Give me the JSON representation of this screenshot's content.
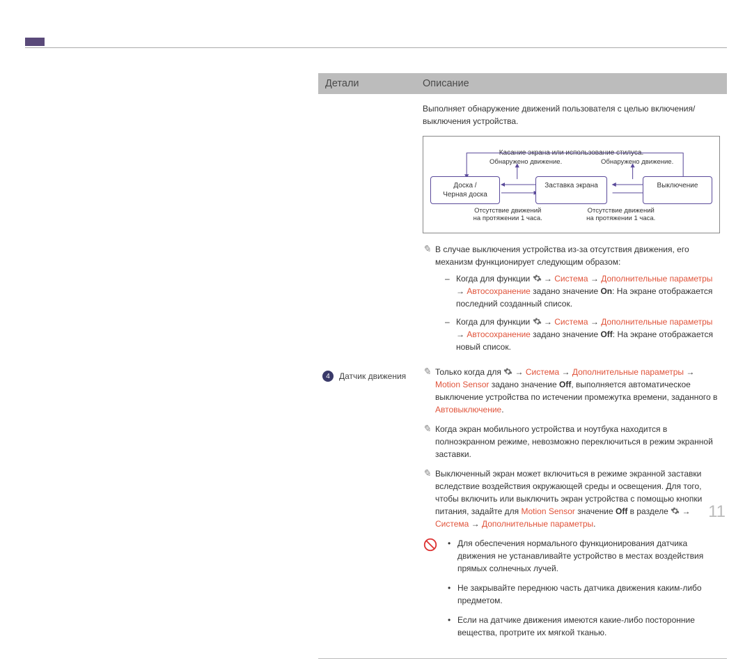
{
  "page_number": "11",
  "header": {
    "col1": "Детали",
    "col2": "Описание"
  },
  "row_label": {
    "num": "4",
    "text": "Датчик движения"
  },
  "intro": "Выполняет обнаружение движений пользователя с целью включения/выключения устройства.",
  "diagram": {
    "top_label": "Касание экрана или использование стилуса.",
    "detected1": "Обнаружено движение.",
    "detected2": "Обнаружено движение.",
    "box1_l1": "Доска /",
    "box1_l2": "Черная доска",
    "box2": "Заставка экрана",
    "box3": "Выключение",
    "no_motion1_l1": "Отсутствие движений",
    "no_motion1_l2": "на протяжении 1 часа.",
    "no_motion2_l1": "Отсутствие движений",
    "no_motion2_l2": "на протяжении 1 часа."
  },
  "notes": {
    "n1_intro": "В случае выключения устройства из-за отсутствия движения, его механизм функционирует следующим образом:",
    "n1_i1_a": "Когда для функции ",
    "n1_i1_b": " → ",
    "n1_i1_sys": "Система",
    "n1_i1_arr": " → ",
    "n1_i1_adv": "Дополнительные параметры",
    "n1_i1_arr2": " → ",
    "n1_i1_auto": "Автосохранение",
    "n1_i1_rest": " задано значение ",
    "n1_i1_on": "On",
    "n1_i1_tail": ": На экране отображается последний созданный список.",
    "n1_i2_a": "Когда для функции ",
    "n1_i2_rest": " задано значение ",
    "n1_i2_off": "Off",
    "n1_i2_tail": ": На экране отображается новый список.",
    "n2_a": "Только когда для ",
    "n2_ms": "Motion Sensor",
    "n2_mid": " задано значение ",
    "n2_off": "Off",
    "n2_mid2": ", выполняется автоматическое выключение устройства по истечении промежутка времени, заданного в ",
    "n2_auto": "Автовыключение",
    "n2_dot": ".",
    "n3": "Когда экран мобильного устройства и ноутбука находится в полноэкранном режиме, невозможно переключиться в режим экранной заставки.",
    "n4_a": "Выключенный экран может включиться в режиме экранной заставки вследствие воздействия окружающей среды и освещения. Для того, чтобы включить или выключить экран устройства с помощью кнопки питания, задайте для ",
    "n4_ms": "Motion Sensor",
    "n4_mid": " значение ",
    "n4_off": "Off",
    "n4_mid2": " в разделе ",
    "n4_sys": "Система",
    "n4_arr": " → ",
    "n4_adv": "Дополнительные параметры",
    "n4_dot": "."
  },
  "warn": {
    "w1": "Для обеспечения нормального функционирования датчика движения не устанавливайте устройство в местах воздействия прямых солнечных лучей.",
    "w2": "Не закрывайте переднюю часть датчика движения каким-либо предметом.",
    "w3": "Если на датчике движения имеются какие-либо посторонние вещества, протрите их мягкой тканью."
  }
}
